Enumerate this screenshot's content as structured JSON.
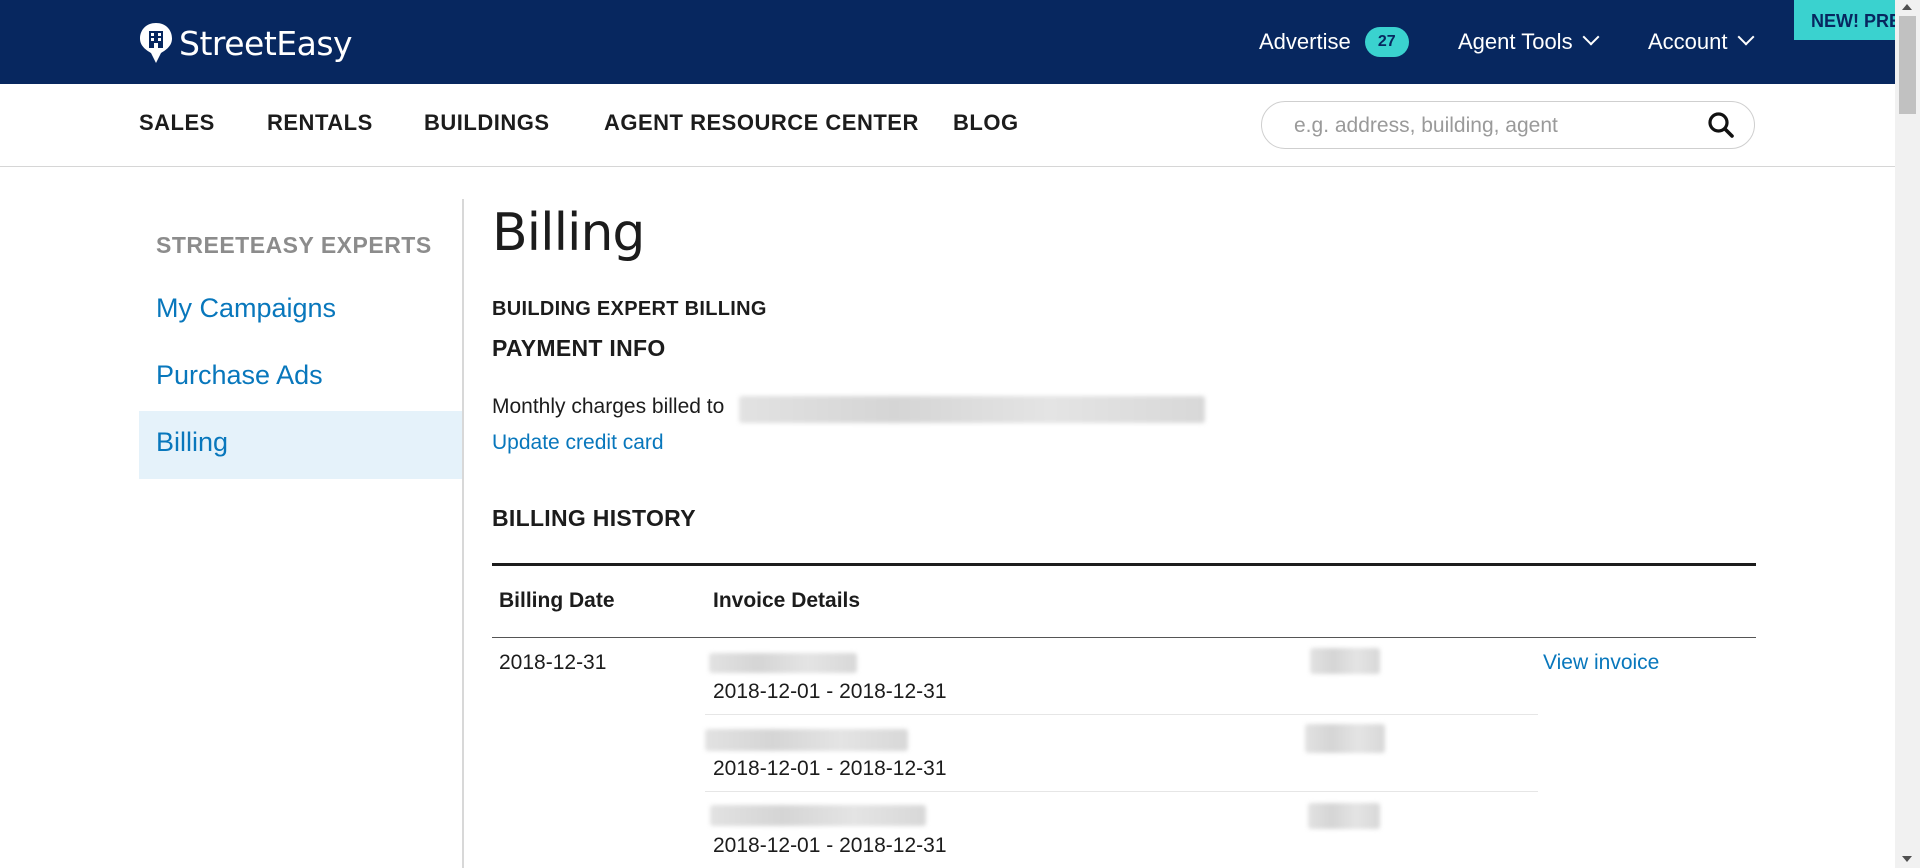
{
  "header": {
    "brand": "StreetEasy",
    "advertise_label": "Advertise",
    "advertise_badge": "27",
    "agent_tools_label": "Agent Tools",
    "account_label": "Account",
    "promo_label": "NEW! PRE"
  },
  "subnav": {
    "items": [
      "SALES",
      "RENTALS",
      "BUILDINGS",
      "AGENT RESOURCE CENTER",
      "BLOG"
    ],
    "search_placeholder": "e.g. address, building, agent"
  },
  "sidebar": {
    "heading": "STREETEASY EXPERTS",
    "items": [
      "My Campaigns",
      "Purchase Ads",
      "Billing"
    ],
    "active_item": "Billing"
  },
  "main": {
    "title": "Billing",
    "section_label": "BUILDING EXPERT BILLING",
    "payment_heading": "PAYMENT INFO",
    "monthly_charges_text": "Monthly charges billed to",
    "update_card_link": "Update credit card",
    "history_heading": "BILLING HISTORY",
    "table": {
      "headers": [
        "Billing Date",
        "Invoice Details"
      ],
      "billing_date": "2018-12-31",
      "view_invoice_link": "View invoice",
      "line_items": [
        {
          "period": "2018-12-01 - 2018-12-31"
        },
        {
          "period": "2018-12-01 - 2018-12-31"
        },
        {
          "period": "2018-12-01 - 2018-12-31"
        }
      ]
    }
  },
  "colors": {
    "navy": "#07275f",
    "teal": "#3ad2cf",
    "link_blue": "#0877bc",
    "active_bg": "#e5f2fa"
  }
}
